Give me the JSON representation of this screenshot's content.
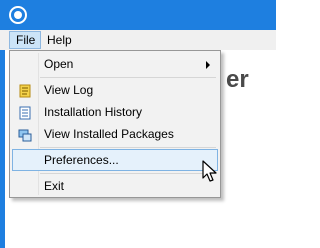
{
  "window": {
    "app_icon": "app-icon"
  },
  "menubar": {
    "file_label": "File",
    "help_label": "Help"
  },
  "background": {
    "partial_text": "er"
  },
  "file_menu": {
    "items": [
      {
        "label": "Open",
        "has_submenu": true,
        "icon": null
      },
      {
        "label": "View Log",
        "icon": "log-icon"
      },
      {
        "label": "Installation History",
        "icon": "history-icon"
      },
      {
        "label": "View Installed Packages",
        "icon": "packages-icon"
      },
      {
        "label": "Preferences...",
        "icon": null,
        "highlighted": true
      },
      {
        "label": "Exit",
        "icon": null
      }
    ]
  },
  "colors": {
    "accent": "#1e7fe0",
    "highlight_bg": "#e5f1fb",
    "highlight_border": "#7fb3e3"
  }
}
